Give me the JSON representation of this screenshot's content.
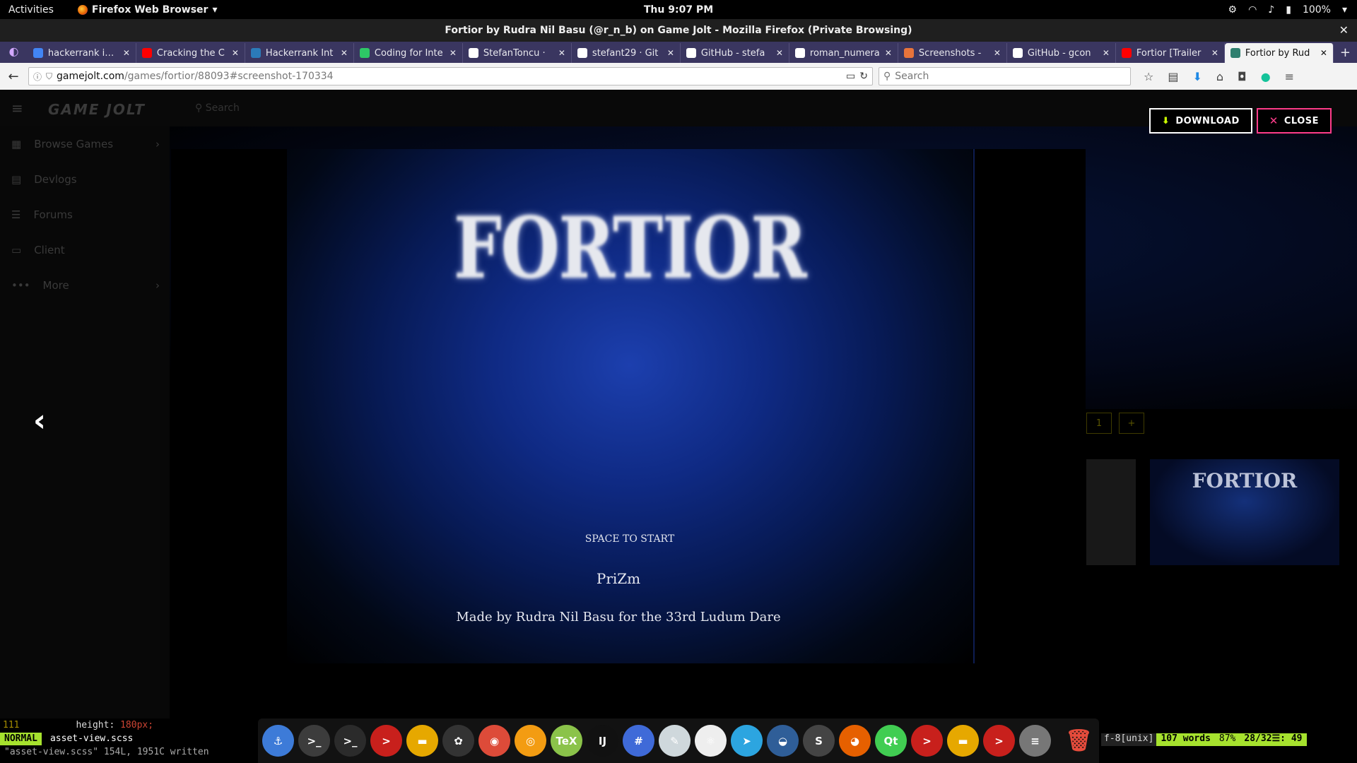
{
  "topbar": {
    "activities": "Activities",
    "app_name": "Firefox Web Browser",
    "clock": "Thu  9:07 PM",
    "battery": "100%"
  },
  "window": {
    "title": "Fortior by Rudra Nil Basu (@r_n_b) on Game Jolt - Mozilla Firefox (Private Browsing)"
  },
  "tabs": [
    {
      "label": "hackerrank inte",
      "fav": "#4285f4"
    },
    {
      "label": "Cracking the C",
      "fav": "#ff0000"
    },
    {
      "label": "Hackerrank Int",
      "fav": "#2b7bb9"
    },
    {
      "label": "Coding for Inte",
      "fav": "#2ec866"
    },
    {
      "label": "StefanToncu ·",
      "fav": "#ffffff"
    },
    {
      "label": "stefant29 · Git",
      "fav": "#ffffff"
    },
    {
      "label": "GitHub - stefa",
      "fav": "#ffffff"
    },
    {
      "label": "roman_numera",
      "fav": "#ffffff"
    },
    {
      "label": "Screenshots -",
      "fav": "#e8743b"
    },
    {
      "label": "GitHub - gcon",
      "fav": "#ffffff"
    },
    {
      "label": "Fortior [Trailer",
      "fav": "#ff0000"
    },
    {
      "label": "Fortior by Rud",
      "fav": "#2f7f6f"
    }
  ],
  "nav": {
    "url_domain": "gamejolt.com",
    "url_path": "/games/fortior/88093#screenshot-170334",
    "search_placeholder": "Search"
  },
  "gamejolt": {
    "logo": "GAME JOLT",
    "search_placeholder": "Search",
    "sidebar": [
      {
        "label": "Browse Games",
        "icon": "▦",
        "chevron": true
      },
      {
        "label": "Devlogs",
        "icon": "▤",
        "chevron": false
      },
      {
        "label": "Forums",
        "icon": "☰",
        "chevron": false
      },
      {
        "label": "Client",
        "icon": "▭",
        "chevron": false
      },
      {
        "label": "More",
        "icon": "•••",
        "chevron": true
      }
    ],
    "pager_current": "1",
    "pager_plus": "+",
    "thumb_title": "FORTIOR"
  },
  "lightbox": {
    "download_label": "DOWNLOAD",
    "close_label": "CLOSE",
    "prev_icon": "‹"
  },
  "screenshot": {
    "title": "FORTIOR",
    "prompt": "SPACE TO START",
    "studio": "PriZm",
    "credit": "Made by Rudra Nil Basu for the 33rd Ludum Dare"
  },
  "vim": {
    "line_no": "111",
    "code_line": "height: ",
    "code_value": "180px;",
    "mode": "NORMAL",
    "filename": "asset-view.scss",
    "message": "\"asset-view.scss\" 154L, 1951C written",
    "encoding": "f-8[unix]",
    "words": "107 words",
    "percent": "87%",
    "position": "28/32☰: 49"
  },
  "dock": [
    {
      "name": "anchor-icon",
      "glyph": "⚓",
      "bg": "#3d7bd8"
    },
    {
      "name": "terminal-icon",
      "glyph": ">_",
      "bg": "#3c3c3c"
    },
    {
      "name": "terminal-alt-icon",
      "glyph": ">_",
      "bg": "#2b2b2b"
    },
    {
      "name": "redis-icon",
      "glyph": ">",
      "bg": "#c8201c"
    },
    {
      "name": "files-icon",
      "glyph": "▬",
      "bg": "#e6a800"
    },
    {
      "name": "gear-icon",
      "glyph": "✿",
      "bg": "#333"
    },
    {
      "name": "chrome-icon",
      "glyph": "◉",
      "bg": "#dd4b39"
    },
    {
      "name": "camera-icon",
      "glyph": "◎",
      "bg": "#f39c12"
    },
    {
      "name": "tex-icon",
      "glyph": "TeX",
      "bg": "#8bc34a"
    },
    {
      "name": "intellij-icon",
      "glyph": "IJ",
      "bg": "#111"
    },
    {
      "name": "slack-icon",
      "glyph": "#",
      "bg": "#3f6ad8"
    },
    {
      "name": "tool-icon",
      "glyph": "✎",
      "bg": "#cfd8dc"
    },
    {
      "name": "atom-icon",
      "glyph": "⚛",
      "bg": "#eee"
    },
    {
      "name": "telegram-icon",
      "glyph": "➤",
      "bg": "#2ca5e0"
    },
    {
      "name": "blender-icon",
      "glyph": "◒",
      "bg": "#2f5e98"
    },
    {
      "name": "sublime-icon",
      "glyph": "S",
      "bg": "#444"
    },
    {
      "name": "firefox-icon",
      "glyph": "◕",
      "bg": "#e66000"
    },
    {
      "name": "qt-icon",
      "glyph": "Qt",
      "bg": "#41cd52"
    },
    {
      "name": "redis2-icon",
      "glyph": ">",
      "bg": "#c8201c"
    },
    {
      "name": "folder-icon",
      "glyph": "▬",
      "bg": "#e6a800"
    },
    {
      "name": "redis3-icon",
      "glyph": ">",
      "bg": "#c8201c"
    },
    {
      "name": "text-editor-icon",
      "glyph": "≡",
      "bg": "#777"
    }
  ]
}
